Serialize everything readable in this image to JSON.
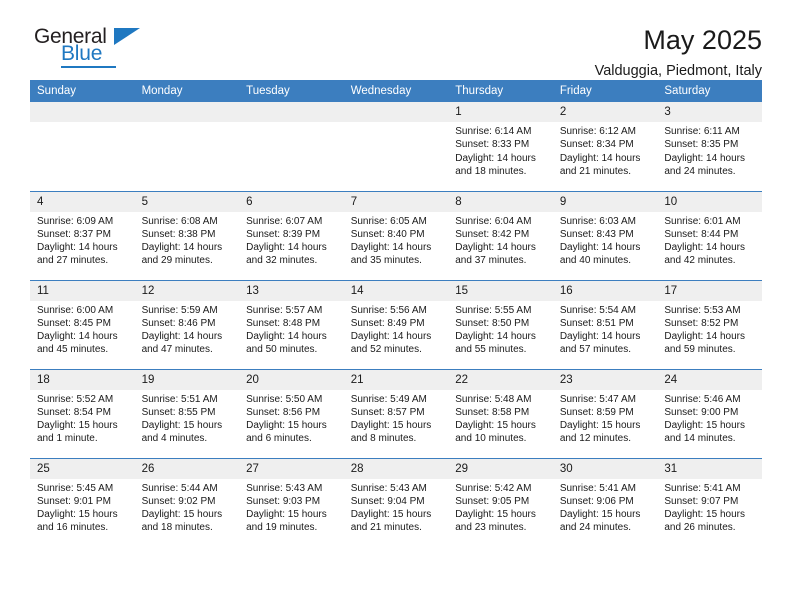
{
  "logo": {
    "word_top": "General",
    "word_bottom": "Blue",
    "accent_color": "#1f78c1",
    "triangle_icon": "blue-triangle-icon"
  },
  "header": {
    "title": "May 2025",
    "subtitle": "Valduggia, Piedmont, Italy"
  },
  "calendar": {
    "header_bg": "#3c7ebf",
    "daynum_bg": "#efefef",
    "weekdays": [
      "Sunday",
      "Monday",
      "Tuesday",
      "Wednesday",
      "Thursday",
      "Friday",
      "Saturday"
    ],
    "weeks": [
      [
        {
          "day": "",
          "empty": true
        },
        {
          "day": "",
          "empty": true
        },
        {
          "day": "",
          "empty": true
        },
        {
          "day": "",
          "empty": true
        },
        {
          "day": "1",
          "sunrise": "Sunrise: 6:14 AM",
          "sunset": "Sunset: 8:33 PM",
          "daylight": "Daylight: 14 hours and 18 minutes."
        },
        {
          "day": "2",
          "sunrise": "Sunrise: 6:12 AM",
          "sunset": "Sunset: 8:34 PM",
          "daylight": "Daylight: 14 hours and 21 minutes."
        },
        {
          "day": "3",
          "sunrise": "Sunrise: 6:11 AM",
          "sunset": "Sunset: 8:35 PM",
          "daylight": "Daylight: 14 hours and 24 minutes."
        }
      ],
      [
        {
          "day": "4",
          "sunrise": "Sunrise: 6:09 AM",
          "sunset": "Sunset: 8:37 PM",
          "daylight": "Daylight: 14 hours and 27 minutes."
        },
        {
          "day": "5",
          "sunrise": "Sunrise: 6:08 AM",
          "sunset": "Sunset: 8:38 PM",
          "daylight": "Daylight: 14 hours and 29 minutes."
        },
        {
          "day": "6",
          "sunrise": "Sunrise: 6:07 AM",
          "sunset": "Sunset: 8:39 PM",
          "daylight": "Daylight: 14 hours and 32 minutes."
        },
        {
          "day": "7",
          "sunrise": "Sunrise: 6:05 AM",
          "sunset": "Sunset: 8:40 PM",
          "daylight": "Daylight: 14 hours and 35 minutes."
        },
        {
          "day": "8",
          "sunrise": "Sunrise: 6:04 AM",
          "sunset": "Sunset: 8:42 PM",
          "daylight": "Daylight: 14 hours and 37 minutes."
        },
        {
          "day": "9",
          "sunrise": "Sunrise: 6:03 AM",
          "sunset": "Sunset: 8:43 PM",
          "daylight": "Daylight: 14 hours and 40 minutes."
        },
        {
          "day": "10",
          "sunrise": "Sunrise: 6:01 AM",
          "sunset": "Sunset: 8:44 PM",
          "daylight": "Daylight: 14 hours and 42 minutes."
        }
      ],
      [
        {
          "day": "11",
          "sunrise": "Sunrise: 6:00 AM",
          "sunset": "Sunset: 8:45 PM",
          "daylight": "Daylight: 14 hours and 45 minutes."
        },
        {
          "day": "12",
          "sunrise": "Sunrise: 5:59 AM",
          "sunset": "Sunset: 8:46 PM",
          "daylight": "Daylight: 14 hours and 47 minutes."
        },
        {
          "day": "13",
          "sunrise": "Sunrise: 5:57 AM",
          "sunset": "Sunset: 8:48 PM",
          "daylight": "Daylight: 14 hours and 50 minutes."
        },
        {
          "day": "14",
          "sunrise": "Sunrise: 5:56 AM",
          "sunset": "Sunset: 8:49 PM",
          "daylight": "Daylight: 14 hours and 52 minutes."
        },
        {
          "day": "15",
          "sunrise": "Sunrise: 5:55 AM",
          "sunset": "Sunset: 8:50 PM",
          "daylight": "Daylight: 14 hours and 55 minutes."
        },
        {
          "day": "16",
          "sunrise": "Sunrise: 5:54 AM",
          "sunset": "Sunset: 8:51 PM",
          "daylight": "Daylight: 14 hours and 57 minutes."
        },
        {
          "day": "17",
          "sunrise": "Sunrise: 5:53 AM",
          "sunset": "Sunset: 8:52 PM",
          "daylight": "Daylight: 14 hours and 59 minutes."
        }
      ],
      [
        {
          "day": "18",
          "sunrise": "Sunrise: 5:52 AM",
          "sunset": "Sunset: 8:54 PM",
          "daylight": "Daylight: 15 hours and 1 minute."
        },
        {
          "day": "19",
          "sunrise": "Sunrise: 5:51 AM",
          "sunset": "Sunset: 8:55 PM",
          "daylight": "Daylight: 15 hours and 4 minutes."
        },
        {
          "day": "20",
          "sunrise": "Sunrise: 5:50 AM",
          "sunset": "Sunset: 8:56 PM",
          "daylight": "Daylight: 15 hours and 6 minutes."
        },
        {
          "day": "21",
          "sunrise": "Sunrise: 5:49 AM",
          "sunset": "Sunset: 8:57 PM",
          "daylight": "Daylight: 15 hours and 8 minutes."
        },
        {
          "day": "22",
          "sunrise": "Sunrise: 5:48 AM",
          "sunset": "Sunset: 8:58 PM",
          "daylight": "Daylight: 15 hours and 10 minutes."
        },
        {
          "day": "23",
          "sunrise": "Sunrise: 5:47 AM",
          "sunset": "Sunset: 8:59 PM",
          "daylight": "Daylight: 15 hours and 12 minutes."
        },
        {
          "day": "24",
          "sunrise": "Sunrise: 5:46 AM",
          "sunset": "Sunset: 9:00 PM",
          "daylight": "Daylight: 15 hours and 14 minutes."
        }
      ],
      [
        {
          "day": "25",
          "sunrise": "Sunrise: 5:45 AM",
          "sunset": "Sunset: 9:01 PM",
          "daylight": "Daylight: 15 hours and 16 minutes."
        },
        {
          "day": "26",
          "sunrise": "Sunrise: 5:44 AM",
          "sunset": "Sunset: 9:02 PM",
          "daylight": "Daylight: 15 hours and 18 minutes."
        },
        {
          "day": "27",
          "sunrise": "Sunrise: 5:43 AM",
          "sunset": "Sunset: 9:03 PM",
          "daylight": "Daylight: 15 hours and 19 minutes."
        },
        {
          "day": "28",
          "sunrise": "Sunrise: 5:43 AM",
          "sunset": "Sunset: 9:04 PM",
          "daylight": "Daylight: 15 hours and 21 minutes."
        },
        {
          "day": "29",
          "sunrise": "Sunrise: 5:42 AM",
          "sunset": "Sunset: 9:05 PM",
          "daylight": "Daylight: 15 hours and 23 minutes."
        },
        {
          "day": "30",
          "sunrise": "Sunrise: 5:41 AM",
          "sunset": "Sunset: 9:06 PM",
          "daylight": "Daylight: 15 hours and 24 minutes."
        },
        {
          "day": "31",
          "sunrise": "Sunrise: 5:41 AM",
          "sunset": "Sunset: 9:07 PM",
          "daylight": "Daylight: 15 hours and 26 minutes."
        }
      ]
    ]
  }
}
